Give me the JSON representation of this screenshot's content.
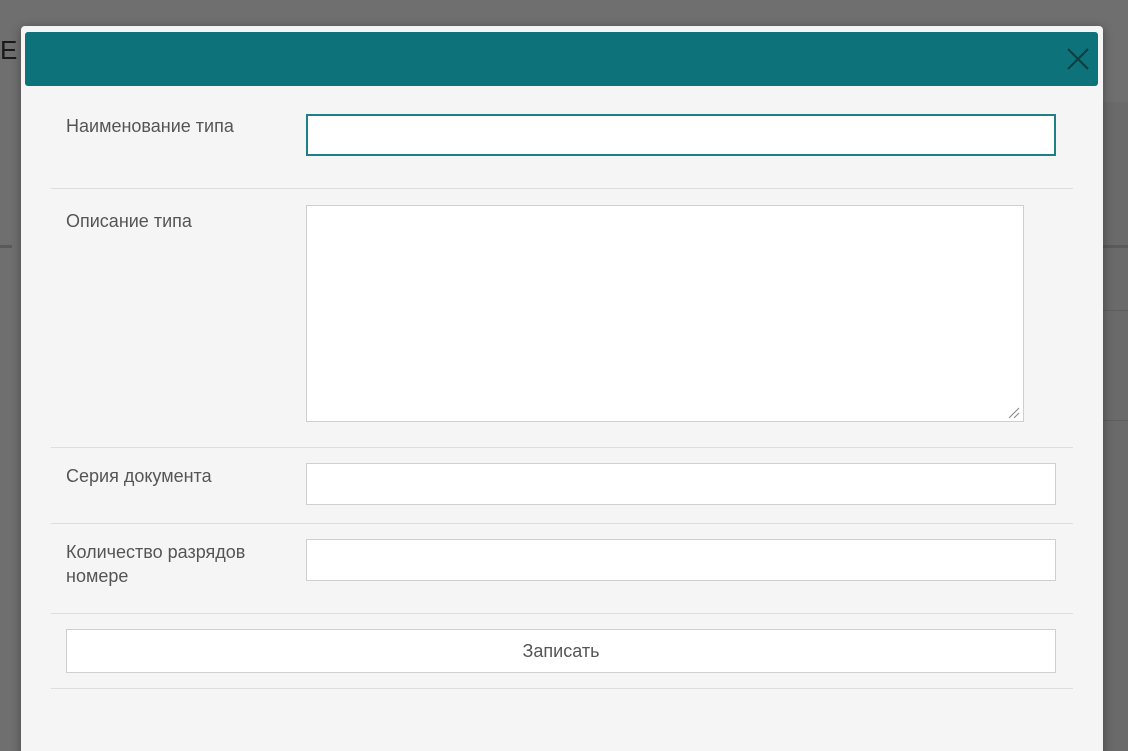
{
  "background": {
    "partial_title_letter": "E"
  },
  "modal": {
    "header_color": "#0d727a",
    "close_icon": "close-icon",
    "fields": {
      "type_name": {
        "label": "Наименование типа",
        "value": ""
      },
      "type_description": {
        "label": "Описание типа",
        "value": ""
      },
      "document_series": {
        "label": "Серия документа",
        "value": ""
      },
      "number_digits": {
        "label": "Количество разрядов номере",
        "value": ""
      }
    },
    "submit_label": "Записать"
  }
}
